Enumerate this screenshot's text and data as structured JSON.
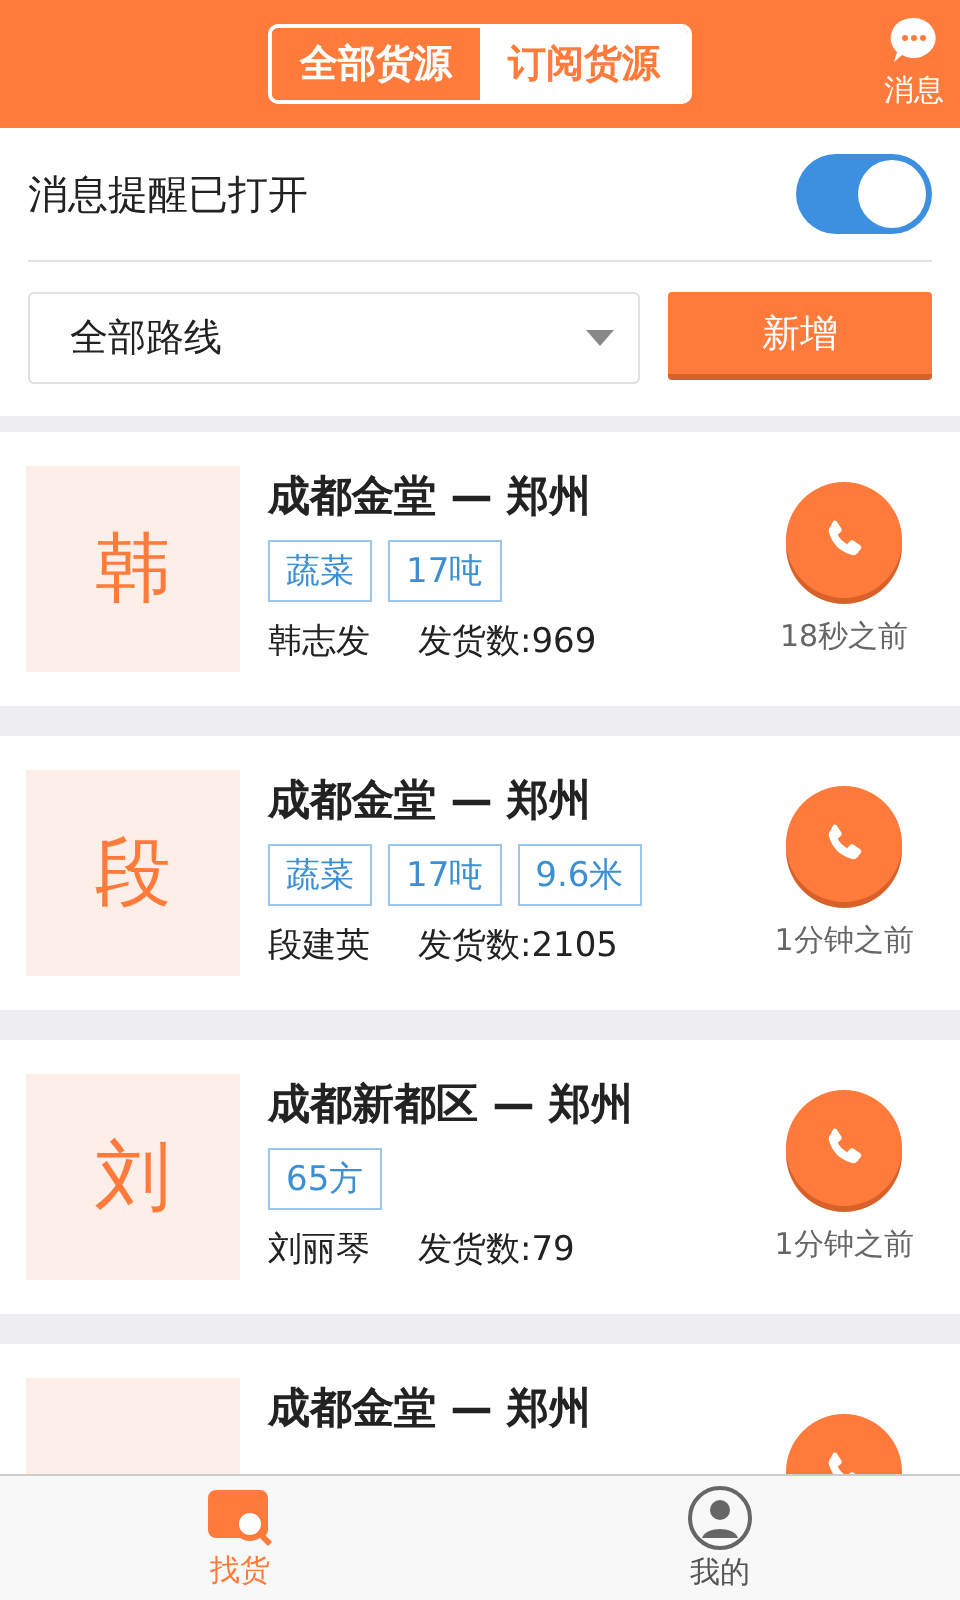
{
  "header": {
    "tabs": [
      {
        "label": "全部货源",
        "selected": true
      },
      {
        "label": "订阅货源",
        "selected": false
      }
    ],
    "message": {
      "label": "消息"
    }
  },
  "notify": {
    "label": "消息提醒已打开",
    "on": true
  },
  "route_filter": {
    "value": "全部路线"
  },
  "add_button": "新增",
  "listings": [
    {
      "avatar": "韩",
      "route": "成都金堂 — 郑州",
      "tags": [
        "蔬菜",
        "17吨"
      ],
      "contact": "韩志发",
      "shipments": "发货数:969",
      "time": "18秒之前"
    },
    {
      "avatar": "段",
      "route": "成都金堂 — 郑州",
      "tags": [
        "蔬菜",
        "17吨",
        "9.6米"
      ],
      "contact": "段建英",
      "shipments": "发货数:2105",
      "time": "1分钟之前"
    },
    {
      "avatar": "刘",
      "route": "成都新都区 — 郑州",
      "tags": [
        "65方"
      ],
      "contact": "刘丽琴",
      "shipments": "发货数:79",
      "time": "1分钟之前"
    },
    {
      "route": "成都金堂 — 郑州"
    }
  ],
  "bottom_nav": [
    {
      "label": "找货",
      "selected": true,
      "kind": "search"
    },
    {
      "label": "我的",
      "selected": false,
      "kind": "profile"
    }
  ]
}
